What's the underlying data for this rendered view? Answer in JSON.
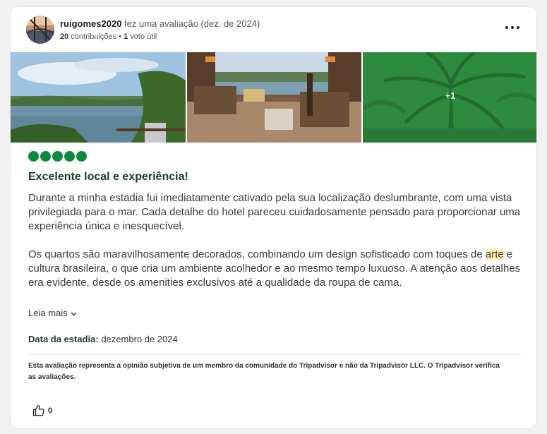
{
  "review": {
    "username": "ruigomes2020",
    "action": " fez uma avaliação (dez. de 2024)",
    "contributions_count": "20",
    "contributions_label": " contribuições • ",
    "helpful_count": "1",
    "helpful_label": " voto útil",
    "photos": {
      "more_label": "+1"
    },
    "rating": 5,
    "title": "Excelente local e experiência!",
    "body_p1": "Durante a minha estadia fui imediatamente cativado pela sua localização deslumbrante, com uma vista privilegiada para o mar. Cada detalhe do hotel pareceu cuidadosamente pensado para proporcionar uma experiência única e inesquecível.",
    "body_p2_before": "Os quartos são maravilhosamente decorados, combinando um design sofisticado com toques de ",
    "body_p2_highlight": "arte",
    "body_p2_after": " e cultura brasileira, o que cria um ambiente acolhedor e ao mesmo tempo luxuoso. A atenção aos detalhes era evidente, desde os amenities exclusivos até a qualidade da roupa de cama.",
    "read_more": "Leia mais",
    "stay_label": "Data da estadia:",
    "stay_value": " dezembro de 2024",
    "disclaimer": "Esta avaliação representa a opinião subjetiva de um membro da comunidade do Tripadvisor e não da Tripadvisor LLC. O Tripadvisor verifica as avaliações.",
    "likes": "0"
  },
  "icons": {
    "more": "more-options-icon",
    "rating": "rating-bubble-icon",
    "like": "thumbs-up-icon",
    "chevron": "chevron-down-icon"
  },
  "colors": {
    "rating_green": "#0b8a3c",
    "title_green": "#1a3b2a",
    "highlight": "#fdf1b3",
    "overlay_green": "#2e8b3e"
  }
}
